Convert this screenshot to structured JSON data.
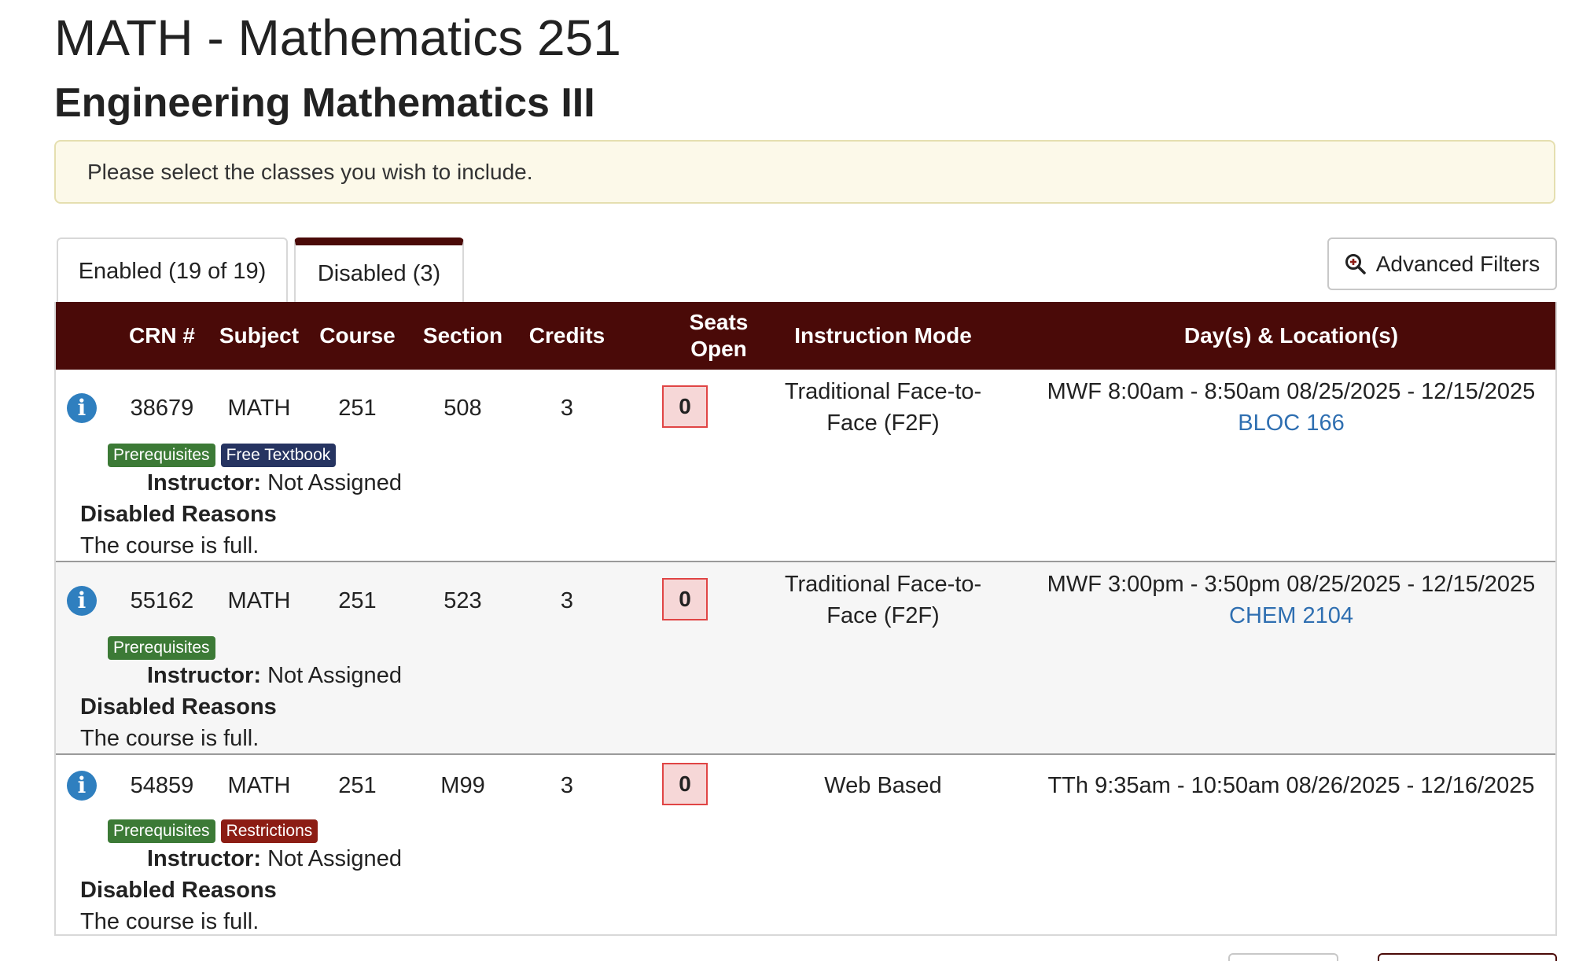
{
  "page": {
    "title": "MATH - Mathematics 251",
    "subtitle": "Engineering Mathematics III"
  },
  "alert": {
    "text": "Please select the classes you wish to include."
  },
  "tabs": {
    "enabled": "Enabled (19 of 19)",
    "disabled": "Disabled (3)",
    "active": "disabled"
  },
  "advanced_filters": {
    "label": "Advanced Filters",
    "icon": "zoom-in-icon"
  },
  "table": {
    "headers": {
      "crn": "CRN #",
      "subject": "Subject",
      "course": "Course",
      "section": "Section",
      "credits": "Credits",
      "seats": "Seats Open",
      "mode": "Instruction Mode",
      "days": "Day(s) & Location(s)"
    },
    "rows": [
      {
        "crn": "38679",
        "subject": "MATH",
        "course": "251",
        "section": "508",
        "credits": "3",
        "seats": "0",
        "mode": "Traditional Face-to-Face (F2F)",
        "schedule": "MWF 8:00am - 8:50am 08/25/2025 - 12/15/2025",
        "location": "BLOC 166",
        "badges": [
          "Prerequisites",
          "Free Textbook"
        ],
        "instructor_label": "Instructor:",
        "instructor": "Not Assigned",
        "reasons_label": "Disabled Reasons",
        "reason": "The course is full."
      },
      {
        "crn": "55162",
        "subject": "MATH",
        "course": "251",
        "section": "523",
        "credits": "3",
        "seats": "0",
        "mode": "Traditional Face-to-Face (F2F)",
        "schedule": "MWF 3:00pm - 3:50pm 08/25/2025 - 12/15/2025",
        "location": "CHEM 2104",
        "badges": [
          "Prerequisites"
        ],
        "instructor_label": "Instructor:",
        "instructor": "Not Assigned",
        "reasons_label": "Disabled Reasons",
        "reason": "The course is full."
      },
      {
        "crn": "54859",
        "subject": "MATH",
        "course": "251",
        "section": "M99",
        "credits": "3",
        "seats": "0",
        "mode": "Web Based",
        "schedule": "TTh 9:35am - 10:50am 08/26/2025 - 12/16/2025",
        "location": "",
        "badges": [
          "Prerequisites",
          "Restrictions"
        ],
        "instructor_label": "Instructor:",
        "instructor": "Not Assigned",
        "reasons_label": "Disabled Reasons",
        "reason": "The course is full."
      }
    ]
  },
  "colors": {
    "header_bg": "#4a0a08",
    "alert_bg": "#fcf9e9",
    "link": "#2f6fb1",
    "badge_prereq": "#3c7a36",
    "badge_textbook": "#263461",
    "badge_restrictions": "#8c1d14",
    "seats_full": "#e04545",
    "info_icon": "#2f7fbf"
  }
}
